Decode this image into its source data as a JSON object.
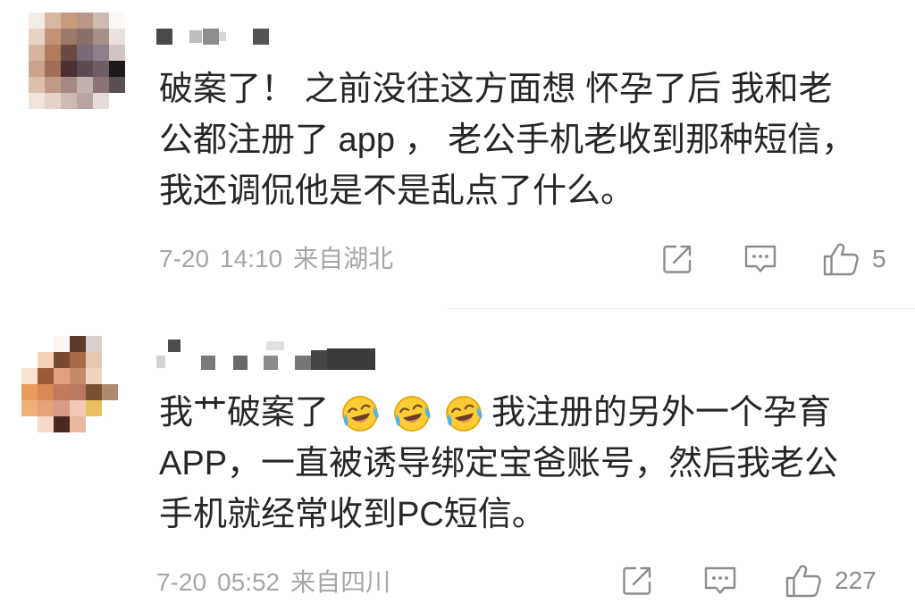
{
  "comments": [
    {
      "text_lines": [
        "破案了！ 之前没往这方面想 怀孕了后 我和老",
        "公都注册了 app ， 老公手机老收到那种短信，",
        "我还调侃他是不是乱点了什么。"
      ],
      "date": "7-20",
      "time": "14:10",
      "location": "来自湖北",
      "like_count": "5",
      "icons": {
        "share": "share-icon",
        "comment": "comment-icon",
        "like": "thumbs-up-icon"
      }
    },
    {
      "first_line": {
        "before": "我艹破案了",
        "emojis": [
          "laughing-crying-emoji",
          "laughing-crying-emoji",
          "laughing-crying-emoji"
        ],
        "after": "我注册的另外一个孕育"
      },
      "text_lines": [
        "APP，一直被诱导绑定宝爸账号，然后我老公",
        "手机就经常收到PC短信。"
      ],
      "date": "7-20",
      "time": "05:52",
      "location": "来自四川",
      "like_count": "227",
      "icons": {
        "share": "share-icon",
        "comment": "comment-icon",
        "like": "thumbs-up-icon"
      }
    }
  ],
  "colors": {
    "text": "#262626",
    "meta": "#a6a6a6",
    "icon": "#8c8c8c",
    "divider": "#ececec"
  }
}
